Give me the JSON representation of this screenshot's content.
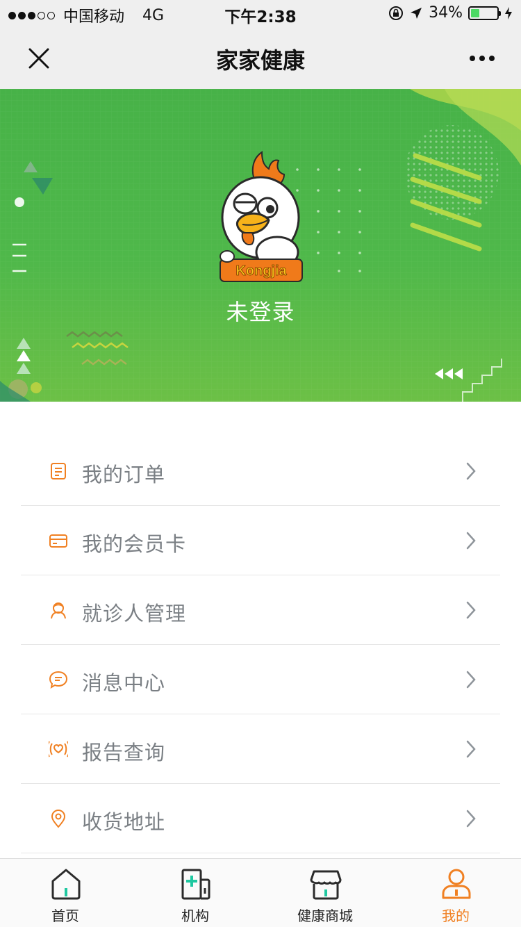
{
  "status_bar": {
    "carrier": "中国移动",
    "network": "4G",
    "time": "下午2:38",
    "battery": "34%",
    "battery_level": 0.34
  },
  "nav": {
    "title": "家家健康"
  },
  "profile": {
    "login_status": "未登录",
    "avatar_text": "Kongjia"
  },
  "menu": [
    {
      "label": "我的订单",
      "icon": "order-icon"
    },
    {
      "label": "我的会员卡",
      "icon": "card-icon"
    },
    {
      "label": "就诊人管理",
      "icon": "patient-icon"
    },
    {
      "label": "消息中心",
      "icon": "message-icon"
    },
    {
      "label": "报告查询",
      "icon": "report-icon"
    },
    {
      "label": "收货地址",
      "icon": "location-icon"
    }
  ],
  "tabs": [
    {
      "label": "首页",
      "icon": "home-icon"
    },
    {
      "label": "机构",
      "icon": "institution-icon"
    },
    {
      "label": "健康商城",
      "icon": "store-icon"
    },
    {
      "label": "我的",
      "icon": "user-icon",
      "active": true
    }
  ],
  "colors": {
    "accent": "#f08022",
    "banner_green": "#4fb84a",
    "tab_teal": "#1ec8a0"
  }
}
